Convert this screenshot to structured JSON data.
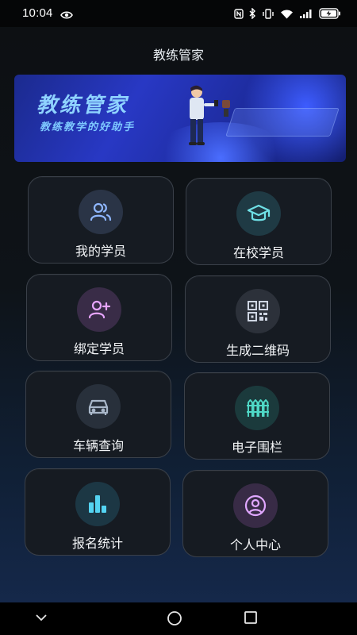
{
  "status_bar": {
    "time": "10:04",
    "icons": [
      "eye-icon",
      "nfc-icon",
      "bluetooth-icon",
      "vibrate-icon",
      "wifi-icon",
      "signal-icon",
      "battery-charging-icon"
    ]
  },
  "page": {
    "title": "教练管家"
  },
  "banner": {
    "title": "教练管家",
    "subtitle": "教练教学的好助手"
  },
  "menu": [
    {
      "label": "我的学员",
      "icon": "users-icon",
      "color": "#8fb7ff"
    },
    {
      "label": "在校学员",
      "icon": "graduation-cap-icon",
      "color": "#6fe0e6"
    },
    {
      "label": "绑定学员",
      "icon": "user-plus-icon",
      "color": "#e7a5ff"
    },
    {
      "label": "生成二维码",
      "icon": "qr-code-icon",
      "color": "#cfd6e3"
    },
    {
      "label": "车辆查询",
      "icon": "car-icon",
      "color": "#a9b7c9"
    },
    {
      "label": "电子围栏",
      "icon": "fence-icon",
      "color": "#4fd8c6"
    },
    {
      "label": "报名统计",
      "icon": "bar-chart-icon",
      "color": "#54d4f2"
    },
    {
      "label": "个人中心",
      "icon": "user-circle-icon",
      "color": "#e0a7ff"
    }
  ],
  "nav_bar": {
    "buttons": [
      "back-icon",
      "home-icon",
      "recents-icon"
    ]
  }
}
